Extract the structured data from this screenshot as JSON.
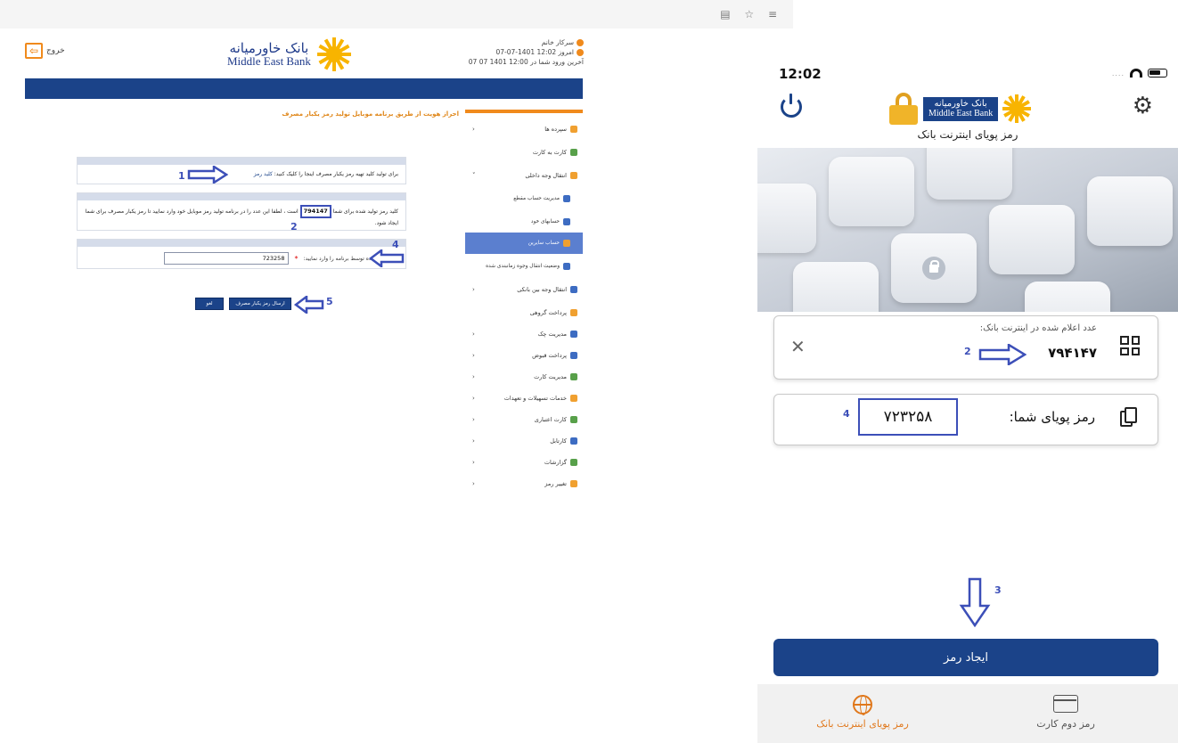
{
  "browser": {
    "icons": "▤ ☆ ≡"
  },
  "web": {
    "exit_label": "خروج",
    "exit_icon": "exit-icon",
    "logo_fa": "بانک خاورمیانه",
    "logo_en": "Middle East Bank",
    "user_name": "سرکار خانم",
    "today": "امروز 12:02 1401-07-07",
    "last_login": "آخرین ورود شما در 12:00 1401 07 07",
    "heading": "احراز هویت از طریق برنامه موبایل تولید رمز یکبار مصرف",
    "panel1_text": "برای تولید کلید تهیه رمز یکبار مصرف اینجا را کلیک کنید:",
    "panel1_link": "کلید رمز",
    "panel2_pre": "کلید رمز تولید شده برای شما",
    "panel2_code": "794147",
    "panel2_post": "است ، لطفا این عدد را در برنامه تولید رمز موبایل خود وارد نمایید تا رمز یکبار مصرف برای شما ایجاد شود.",
    "panel3_label": "رمز ایجاد شده توسط برنامه را وارد نمایید:",
    "panel3_required": "*",
    "panel3_value": "723258",
    "btn_send": "ارسال رمز یکبار مصرف",
    "btn_cancel": "لغو",
    "menu": [
      {
        "label": "سپرده ها",
        "chev": "‹"
      },
      {
        "label": "کارت به کارت",
        "chev": ""
      },
      {
        "label": "انتقال وجه داخلی",
        "chev": "˅"
      },
      {
        "label": "مدیریت حساب مقطع",
        "chev": ""
      },
      {
        "label": "حسابهای خود",
        "chev": ""
      },
      {
        "label": "حساب سایرین",
        "chev": ""
      },
      {
        "label": "وضعیت انتقال وجوه زمانبندی شده",
        "chev": ""
      },
      {
        "label": "انتقال وجه بین بانکی",
        "chev": "‹"
      },
      {
        "label": "پرداخت گروهی",
        "chev": ""
      },
      {
        "label": "مدیریت چک",
        "chev": "‹"
      },
      {
        "label": "پرداخت قبوض",
        "chev": "‹"
      },
      {
        "label": "مدیریت کارت",
        "chev": "‹"
      },
      {
        "label": "خدمات تسهیلات و تعهدات",
        "chev": "‹"
      },
      {
        "label": "کارت اعتباری",
        "chev": "‹"
      },
      {
        "label": "کارتابل",
        "chev": "‹"
      },
      {
        "label": "گزارشات",
        "chev": "‹"
      },
      {
        "label": "تغییر رمز",
        "chev": "‹"
      }
    ]
  },
  "annotations": {
    "n1": "1",
    "n2": "2",
    "n3": "3",
    "n4": "4",
    "n5": "5"
  },
  "mobile": {
    "time": "12:02",
    "status_dots": "....",
    "title": "رمز پویای اینترنت بانک",
    "logo_fa": "بانک خاورمیانه",
    "logo_en": "Middle East Bank",
    "card1_label": "عدد اعلام شده در اینترنت بانک:",
    "card1_value": "۷۹۴۱۴۷",
    "card2_label": "رمز پویای شما:",
    "card2_value": "۷۲۳۲۵۸",
    "close_glyph": "✕",
    "gear_glyph": "⚙",
    "create_button": "ایجاد رمز",
    "tabs": [
      {
        "label": "رمز پویای اینترنت بانک",
        "active": true
      },
      {
        "label": "رمز دوم کارت",
        "active": false
      }
    ]
  },
  "colors": {
    "brand_blue": "#1b4389",
    "accent_orange": "#f08a1c",
    "annotation_blue": "#3c4fb8"
  }
}
